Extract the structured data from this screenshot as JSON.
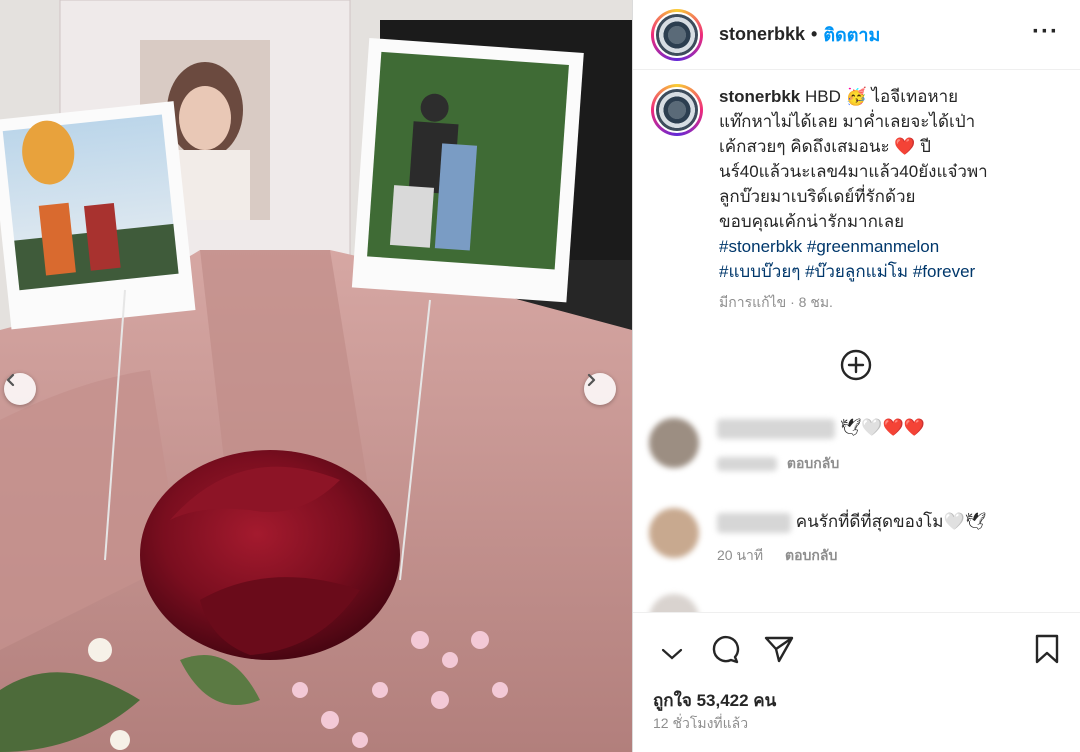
{
  "post": {
    "username": "stonerbkk",
    "dot": "•",
    "follow_label": "ติดตาม",
    "more_label": "···"
  },
  "caption": {
    "username": "stonerbkk",
    "text_line1": " HBD 🥳 ไอจีเทอหาย",
    "text_line2": "แท๊กหาไม่ได้เลย มาค่ำเลยจะได้เป่า",
    "text_line3": "เค้กสวยๆ คิดถึงเสมอนะ ❤️ ปี",
    "text_line4": "นร์40แล้วนะเลข4มาแล้ว40ยังแจ๋วพา",
    "text_line5": "ลูกบ๊วยมาเบริด์เดย์ที่รักด้วย",
    "text_line6": "ขอบคุณเค้กน่ารักมากเลย",
    "hashtags_line1": "#stonerbkk #greenmanmelon",
    "hashtags_line2": "#แบบบ๊วยๆ #บ๊วยลูกแม่โม #forever",
    "edited": "มีการแก้ไข · 8 ชม."
  },
  "comments": [
    {
      "text": "🕊🤍❤️❤️",
      "meta_time": "",
      "reply_label": "ตอบกลับ"
    },
    {
      "text": "คนรักที่ดีที่สุดของโม🤍🕊",
      "meta_time": "20 นาที",
      "reply_label": "ตอบกลับ"
    }
  ],
  "stats": {
    "likes": "ถูกใจ 53,422 คน",
    "posted": "12 ชั่วโมงที่แล้ว"
  },
  "icons": {
    "prev": "chevron-left-icon",
    "next": "chevron-right-icon",
    "load_more": "plus-circle-icon",
    "comment": "comment-icon",
    "share": "share-icon",
    "save": "bookmark-icon"
  },
  "colors": {
    "link": "#0095f6",
    "hashtag": "#00376b",
    "heart": "#ed2f3a"
  }
}
